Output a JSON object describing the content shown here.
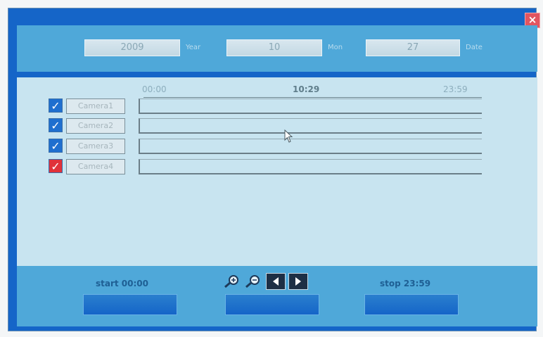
{
  "window": {
    "close_label": "×"
  },
  "date_bar": {
    "year": "2009",
    "year_unit": "Year",
    "month": "10",
    "month_unit": "Mon",
    "day": "27",
    "day_unit": "Date"
  },
  "timeline": {
    "ticks": [
      "00:00",
      "10:29",
      "23:59"
    ],
    "cameras": [
      {
        "label": "Camera1",
        "checked": true,
        "color": "#1f6fcf"
      },
      {
        "label": "Camera2",
        "checked": true,
        "color": "#1f6fcf"
      },
      {
        "label": "Camera3",
        "checked": true,
        "color": "#1f6fcf"
      },
      {
        "label": "Camera4",
        "checked": true,
        "color": "#e0323a"
      }
    ]
  },
  "bottom_bar": {
    "start_label": "start 00:00",
    "stop_label": "stop 23:59",
    "buttons": [
      "",
      "",
      ""
    ],
    "nav_icons": [
      "zoom-in-icon",
      "zoom-out-icon",
      "prev-arrow-icon",
      "next-arrow-icon"
    ]
  },
  "colors": {
    "frame": "#1565c8",
    "panel": "#4fa8d9",
    "content": "#c8e4f0",
    "checked_default": "#1f6fcf",
    "checked_alert": "#e0323a"
  }
}
